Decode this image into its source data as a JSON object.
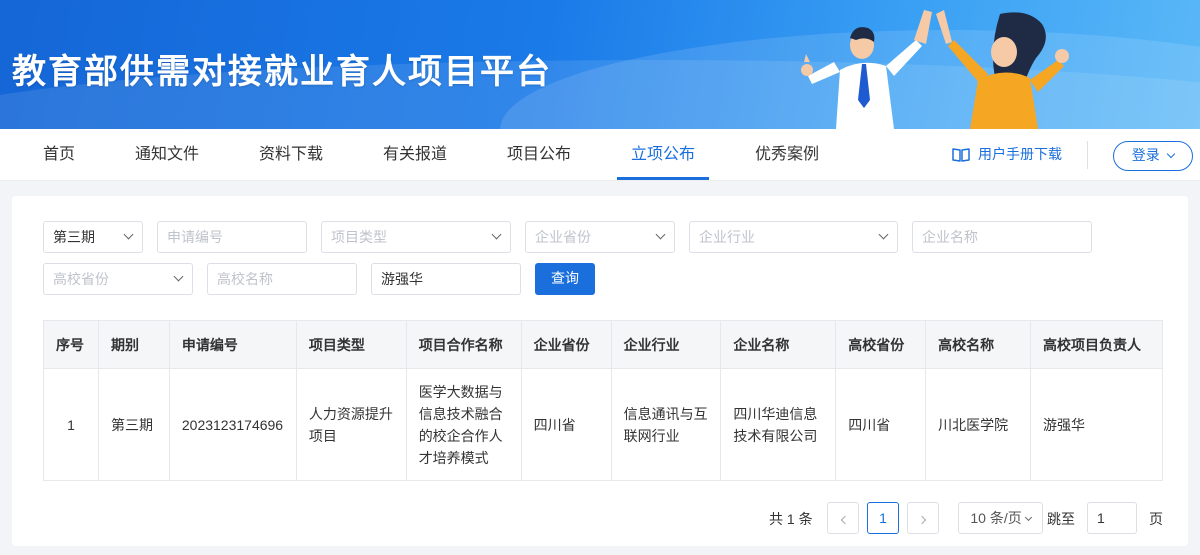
{
  "banner": {
    "title": "教育部供需对接就业育人项目平台"
  },
  "nav": {
    "items": [
      {
        "label": "首页"
      },
      {
        "label": "通知文件"
      },
      {
        "label": "资料下载"
      },
      {
        "label": "有关报道"
      },
      {
        "label": "项目公布"
      },
      {
        "label": "立项公布"
      },
      {
        "label": "优秀案例"
      }
    ],
    "active": "立项公布",
    "manual_label": "用户手册下载",
    "login_label": "登录"
  },
  "filters": {
    "period": {
      "value": "第三期"
    },
    "app_no": {
      "placeholder": "申请编号"
    },
    "project_type": {
      "placeholder": "项目类型"
    },
    "enterprise_province": {
      "placeholder": "企业省份"
    },
    "enterprise_industry": {
      "placeholder": "企业行业"
    },
    "enterprise_name": {
      "placeholder": "企业名称"
    },
    "school_province": {
      "placeholder": "高校省份"
    },
    "school_name": {
      "placeholder": "高校名称"
    },
    "leader": {
      "value": "游强华"
    },
    "query_label": "查询"
  },
  "table": {
    "headers": [
      "序号",
      "期别",
      "申请编号",
      "项目类型",
      "项目合作名称",
      "企业省份",
      "企业行业",
      "企业名称",
      "高校省份",
      "高校名称",
      "高校项目负责人"
    ],
    "rows": [
      [
        "1",
        "第三期",
        "2023123174696",
        "人力资源提升项目",
        "医学大数据与信息技术融合的校企合作人才培养模式",
        "四川省",
        "信息通讯与互联网行业",
        "四川华迪信息技术有限公司",
        "四川省",
        "川北医学院",
        "游强华"
      ]
    ]
  },
  "pagination": {
    "total_label": "共 1 条",
    "current_page": "1",
    "page_size": "10 条/页",
    "jump_label": "跳至",
    "jump_value": "1",
    "page_suffix": "页"
  },
  "colors": {
    "primary": "#1a6fdc",
    "banner": "#1a7ae8"
  }
}
